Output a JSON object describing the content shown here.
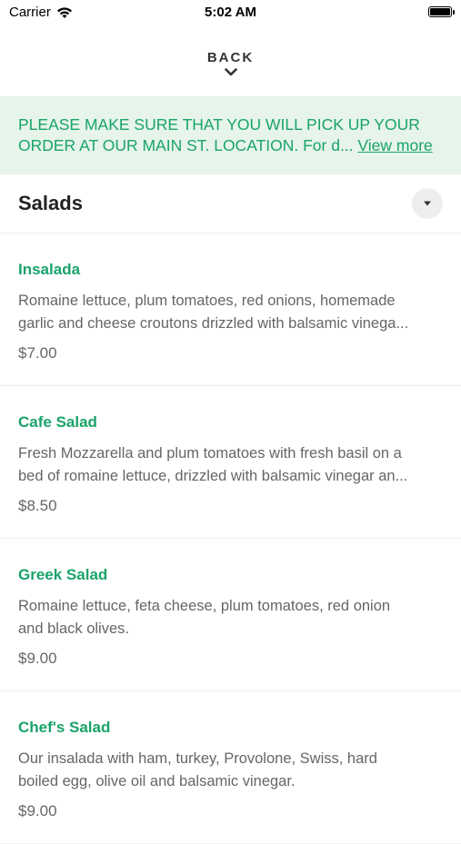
{
  "status_bar": {
    "carrier": "Carrier",
    "time": "5:02 AM"
  },
  "nav": {
    "back_label": "BACK"
  },
  "notice": {
    "line1": "PLEASE MAKE SURE THAT YOU WILL PICK UP YOUR",
    "line2": "ORDER AT OUR MAIN ST. LOCATION. For d...",
    "view_more": "View more"
  },
  "section": {
    "title": "Salads"
  },
  "items": [
    {
      "name": "Insalada",
      "desc_line1": "Romaine lettuce, plum tomatoes, red onions, homemade",
      "desc_line2": "garlic and cheese croutons drizzled with balsamic vinega...",
      "price": "$7.00"
    },
    {
      "name": "Cafe Salad",
      "desc_line1": "Fresh Mozzarella and plum tomatoes with fresh basil on a",
      "desc_line2": "bed of romaine lettuce, drizzled with balsamic vinegar an...",
      "price": "$8.50"
    },
    {
      "name": "Greek Salad",
      "desc_line1": "Romaine lettuce, feta cheese, plum tomatoes, red onion",
      "desc_line2": "and black olives.",
      "price": "$9.00"
    },
    {
      "name": "Chef's Salad",
      "desc_line1": "Our insalada with ham, turkey, Provolone, Swiss, hard",
      "desc_line2": "boiled egg, olive oil and balsamic vinegar.",
      "price": "$9.00"
    }
  ],
  "colors": {
    "accent": "#1aa36b",
    "notice_bg": "#e6f4ea"
  }
}
